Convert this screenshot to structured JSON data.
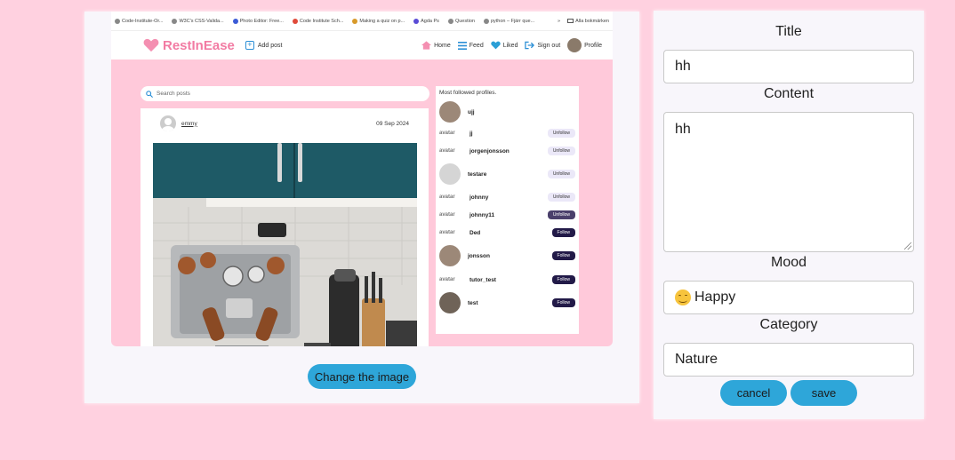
{
  "preview": {
    "bookmarks": [
      "Code-Institute-Or...",
      "W3C's CSS-Valida...",
      "Photo Editor: Free...",
      "Code Institute Sch...",
      "Making a quiz on p...",
      "Agda Ps",
      "Question",
      "python – Fjärr que..."
    ],
    "bookmarks_more": "»",
    "bookmarks_all": "Alla bokmärken",
    "brand": "RestInEase",
    "add_post": "Add post",
    "nav": {
      "home": "Home",
      "feed": "Feed",
      "liked": "Liked",
      "signout": "Sign out",
      "profile": "Profile"
    },
    "search_placeholder": "Search posts",
    "post": {
      "user": "emmy",
      "date": "09 Sep 2024"
    },
    "sidebar_title": "Most followed profiles.",
    "profiles": [
      {
        "name": "ujj",
        "avatar": "photo",
        "button": ""
      },
      {
        "name": "jj",
        "avatar": "broken",
        "button": "Unfollow"
      },
      {
        "name": "jorgenjonsson",
        "avatar": "broken",
        "button": "Unfollow"
      },
      {
        "name": "testare",
        "avatar": "default",
        "button": "Unfollow"
      },
      {
        "name": "johnny",
        "avatar": "broken",
        "button": "Unfollow"
      },
      {
        "name": "johnny11",
        "avatar": "broken",
        "button": "Unfollow"
      },
      {
        "name": "Ded",
        "avatar": "broken",
        "button": "Follow"
      },
      {
        "name": "jonsson",
        "avatar": "photo",
        "button": "Follow"
      },
      {
        "name": "tutor_test",
        "avatar": "broken",
        "button": "Follow"
      },
      {
        "name": "test",
        "avatar": "photo",
        "button": "Follow"
      }
    ],
    "broken_avatar_text": "avatar"
  },
  "change_image_label": "Change the image",
  "form": {
    "title_label": "Title",
    "title_value": "hh",
    "content_label": "Content",
    "content_value": "hh",
    "mood_label": "Mood",
    "mood_value": "Happy",
    "mood_icon": "smiling-face-emoji",
    "category_label": "Category",
    "category_value": "Nature",
    "cancel_label": "cancel",
    "save_label": "save"
  },
  "colors": {
    "background": "#ffd1e0",
    "accent": "#2ea6d9",
    "brand": "#f27ba3",
    "follow": "#221a48"
  }
}
